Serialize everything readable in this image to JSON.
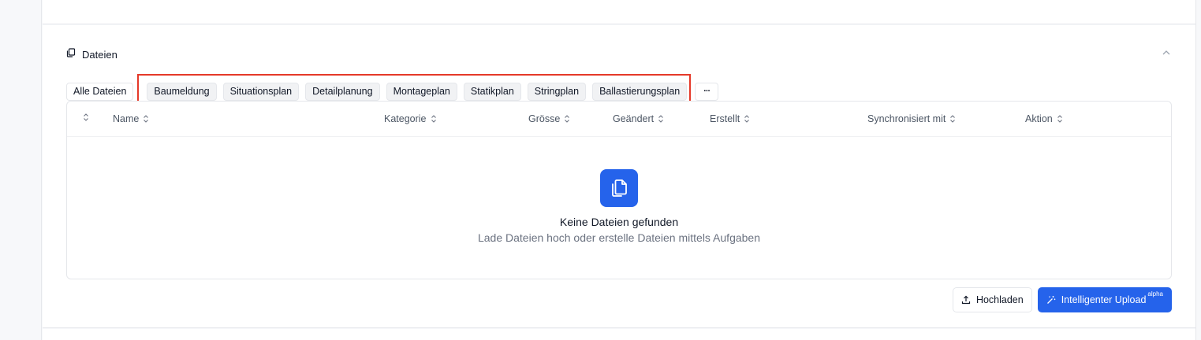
{
  "section": {
    "title": "Dateien"
  },
  "filters": {
    "all_label": "Alle Dateien",
    "categories": [
      "Baumeldung",
      "Situationsplan",
      "Detailplanung",
      "Montageplan",
      "Statikplan",
      "Stringplan",
      "Ballastierungsplan"
    ],
    "more_label": "···"
  },
  "table": {
    "columns": [
      "Name",
      "Kategorie",
      "Grösse",
      "Geändert",
      "Erstellt",
      "Synchronisiert mit",
      "Aktion"
    ]
  },
  "empty_state": {
    "title": "Keine Dateien gefunden",
    "subtitle": "Lade Dateien hoch oder erstelle Dateien mittels Aufgaben"
  },
  "actions": {
    "upload_label": "Hochladen",
    "smart_upload_label": "Intelligenter Upload",
    "smart_upload_badge": "alpha"
  },
  "colors": {
    "accent": "#2563eb",
    "highlight": "#e53929"
  }
}
